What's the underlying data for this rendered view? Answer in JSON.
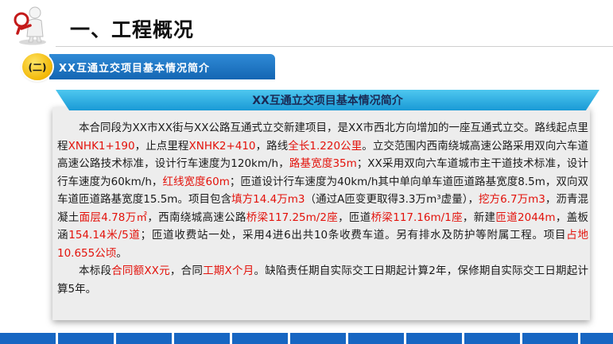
{
  "header": {
    "title": "一、工程概况",
    "logo_icon": "magnifier-figure-icon"
  },
  "section": {
    "badge": "(二)",
    "title": "XX互通立交项目基本情况简介"
  },
  "panel": {
    "title": "XX互通立交项目基本情况简介",
    "p1": {
      "t01": "本合同段为XX市XX街与XX公路互通式立交新建项目，是XX市西北方向增加的一座互通式立交。路线起点里程",
      "h01": "XNHK1+190",
      "t02": "，止点里程",
      "h02": "XNHK2+410",
      "t03": "，路线",
      "h03": "全长1.220公里",
      "t04": "。立交范围内西南绕城高速公路采用双向六车道高速公路技术标准，设计行车速度为120km/h，",
      "h04": "路基宽度35m",
      "t05": "；XX采用双向六车道城市主干道技术标准，设计行车速度为60km/h，",
      "h05": "红线宽度60m",
      "t06": "；匝道设计行车速度为40km/h其中单向单车道匝道路基宽度8.5m，双向双车道匝道路基宽度15.5m。项目包含",
      "h06": "填方14.4万m3",
      "t07": "（通过A匝变更取得3.3万m³虚量），",
      "h07": "挖方6.7万m3",
      "t08": "，沥青混凝土",
      "h08": "面层4.78万㎡",
      "t09": "，西南绕城高速公路",
      "h09": "桥梁117.25m/2座",
      "t10": "，匝道",
      "h10": "桥梁117.16m/1座",
      "t11": "，新建",
      "h11": "匝道2044m",
      "t12": "，盖板涵",
      "h12": "154.14米/5道",
      "t13": "；匝道收费站一处，采用4进6出共10条收费车道。另有排水及防护等附属工程。项目",
      "h13": "占地10.655公顷",
      "t14": "。"
    },
    "p2": {
      "t01": "本标段",
      "h01": "合同额XX元",
      "t02": "，合同",
      "h02": "工期X个月",
      "t03": "。缺陷责任期自实际交工日期起计算2年，保修期自实际交工日期起计算5年。"
    }
  },
  "colors": {
    "accent_blue": "#1466b3",
    "header_cyan": "#1a9ad6",
    "highlight_red": "#e3120b",
    "badge_yellow": "#f2b705"
  }
}
